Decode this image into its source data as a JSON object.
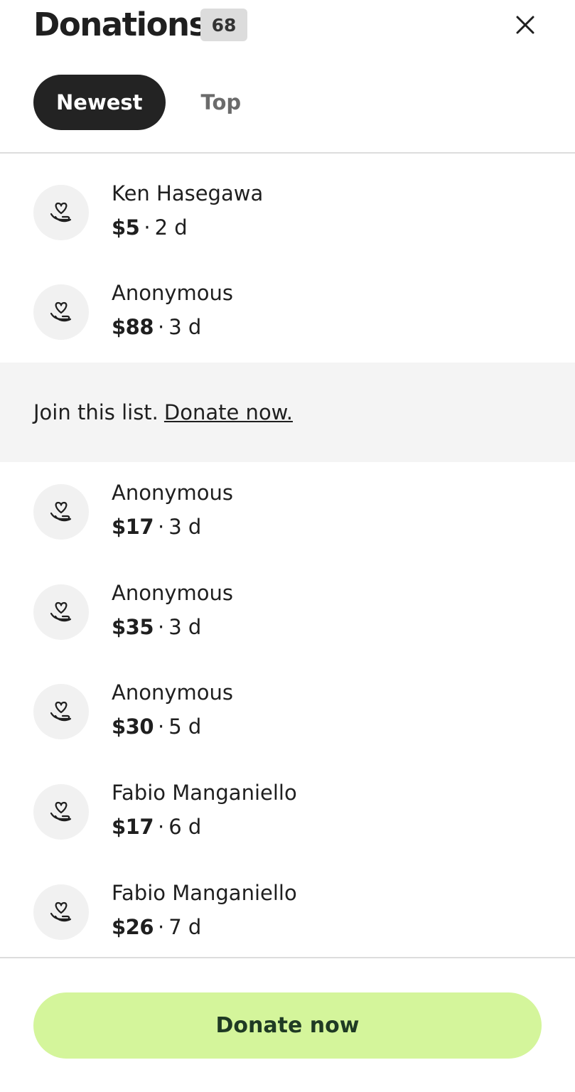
{
  "header": {
    "title": "Donations",
    "count": "68",
    "close_icon": "close-icon"
  },
  "tabs": [
    {
      "label": "Newest",
      "active": true
    },
    {
      "label": "Top",
      "active": false
    }
  ],
  "donations": [
    {
      "name": "Ken Hasegawa",
      "amount": "$5",
      "age": "2 d",
      "icon": "heart-hand-icon"
    },
    {
      "name": "Anonymous",
      "amount": "$88",
      "age": "3 d",
      "icon": "heart-hand-icon"
    },
    {
      "name": "Anonymous",
      "amount": "$17",
      "age": "3 d",
      "icon": "heart-hand-icon"
    },
    {
      "name": "Anonymous",
      "amount": "$35",
      "age": "3 d",
      "icon": "heart-hand-icon"
    },
    {
      "name": "Anonymous",
      "amount": "$30",
      "age": "5 d",
      "icon": "heart-hand-icon"
    },
    {
      "name": "Fabio Manganiello",
      "amount": "$17",
      "age": "6 d",
      "icon": "heart-hand-icon"
    },
    {
      "name": "Fabio Manganiello",
      "amount": "$26",
      "age": "7 d",
      "icon": "heart-hand-icon"
    }
  ],
  "separator": "·",
  "join_banner": {
    "text": "Join this list.",
    "link": "Donate now."
  },
  "footer": {
    "donate_button": "Donate now"
  },
  "colors": {
    "accent": "#d4f59b",
    "active_tab": "#232323"
  }
}
